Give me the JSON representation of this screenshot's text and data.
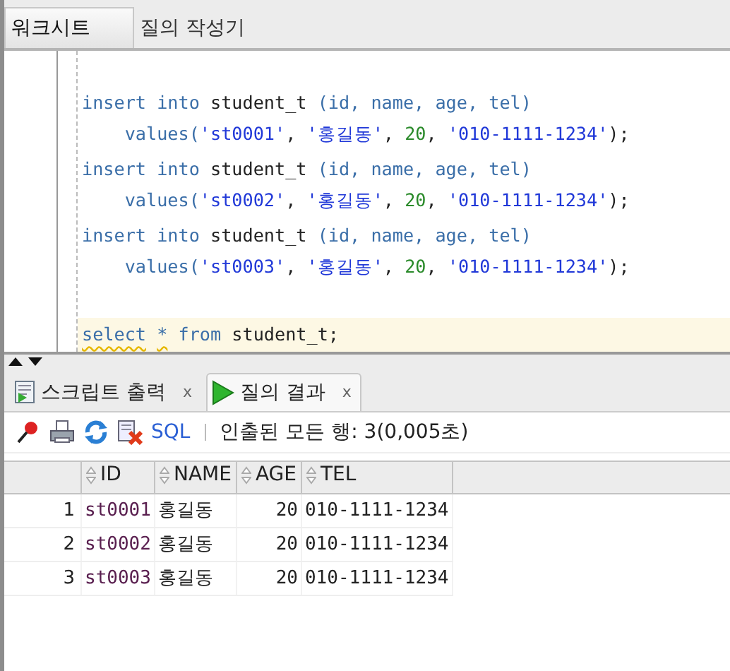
{
  "tabs": [
    {
      "label": "워크시트",
      "selected": true
    },
    {
      "label": "질의 작성기",
      "selected": false
    }
  ],
  "code": {
    "lines": [
      {
        "kind": "blank"
      },
      {
        "kind": "code",
        "highlighted": false,
        "tokens": [
          {
            "kind": "keyword",
            "text": "insert into"
          },
          {
            "kind": "plain",
            "text": " student_t "
          },
          {
            "kind": "keyword",
            "text": "(id, name, age, tel)"
          }
        ]
      },
      {
        "kind": "code",
        "highlighted": false,
        "tokens": [
          {
            "kind": "keyword",
            "text": "    values("
          },
          {
            "kind": "string",
            "text": "'st0001'"
          },
          {
            "kind": "plain",
            "text": ", "
          },
          {
            "kind": "string",
            "text": "'홍길동'"
          },
          {
            "kind": "plain",
            "text": ", "
          },
          {
            "kind": "number",
            "text": "20"
          },
          {
            "kind": "plain",
            "text": ", "
          },
          {
            "kind": "string",
            "text": "'010-1111-1234'"
          },
          {
            "kind": "plain",
            "text": ");"
          }
        ]
      },
      {
        "kind": "code",
        "highlighted": false,
        "tokens": [
          {
            "kind": "keyword",
            "text": "insert into"
          },
          {
            "kind": "plain",
            "text": " student_t "
          },
          {
            "kind": "keyword",
            "text": "(id, name, age, tel)"
          }
        ]
      },
      {
        "kind": "code",
        "highlighted": false,
        "tokens": [
          {
            "kind": "keyword",
            "text": "    values("
          },
          {
            "kind": "string",
            "text": "'st0002'"
          },
          {
            "kind": "plain",
            "text": ", "
          },
          {
            "kind": "string",
            "text": "'홍길동'"
          },
          {
            "kind": "plain",
            "text": ", "
          },
          {
            "kind": "number",
            "text": "20"
          },
          {
            "kind": "plain",
            "text": ", "
          },
          {
            "kind": "string",
            "text": "'010-1111-1234'"
          },
          {
            "kind": "plain",
            "text": ");"
          }
        ]
      },
      {
        "kind": "code",
        "highlighted": false,
        "tokens": [
          {
            "kind": "keyword",
            "text": "insert into"
          },
          {
            "kind": "plain",
            "text": " student_t "
          },
          {
            "kind": "keyword",
            "text": "(id, name, age, tel)"
          }
        ]
      },
      {
        "kind": "code",
        "highlighted": false,
        "tokens": [
          {
            "kind": "keyword",
            "text": "    values("
          },
          {
            "kind": "string",
            "text": "'st0003'"
          },
          {
            "kind": "plain",
            "text": ", "
          },
          {
            "kind": "string",
            "text": "'홍길동'"
          },
          {
            "kind": "plain",
            "text": ", "
          },
          {
            "kind": "number",
            "text": "20"
          },
          {
            "kind": "plain",
            "text": ", "
          },
          {
            "kind": "string",
            "text": "'010-1111-1234'"
          },
          {
            "kind": "plain",
            "text": ");"
          }
        ]
      },
      {
        "kind": "blank"
      },
      {
        "kind": "code",
        "highlighted": true,
        "tokens": [
          {
            "kind": "keyword",
            "text": "select",
            "squiggle": true,
            "space_after": true
          },
          {
            "kind": "keyword",
            "text": "*",
            "squiggle": true,
            "space_after": true
          },
          {
            "kind": "keyword",
            "text": "from"
          },
          {
            "kind": "plain",
            "text": " student_t;"
          }
        ]
      }
    ]
  },
  "output_tabs": [
    {
      "label": "스크립트 출력",
      "kind": "script",
      "close": "x",
      "selected": false
    },
    {
      "label": "질의 결과",
      "kind": "query",
      "close": "x",
      "selected": true
    }
  ],
  "toolbar": {
    "sql_link": "SQL",
    "status": "인출된 모든 행: 3(0,005초)"
  },
  "table": {
    "columns": [
      {
        "label": "ID",
        "kind": "text"
      },
      {
        "label": "NAME",
        "kind": "text"
      },
      {
        "label": "AGE",
        "kind": "number"
      },
      {
        "label": "TEL",
        "kind": "text"
      }
    ],
    "rows": [
      {
        "number": "1",
        "cells": [
          "st0001",
          "홍길동",
          "20",
          "010-1111-1234"
        ]
      },
      {
        "number": "2",
        "cells": [
          "st0002",
          "홍길동",
          "20",
          "010-1111-1234"
        ]
      },
      {
        "number": "3",
        "cells": [
          "st0003",
          "홍길동",
          "20",
          "010-1111-1234"
        ]
      }
    ]
  }
}
